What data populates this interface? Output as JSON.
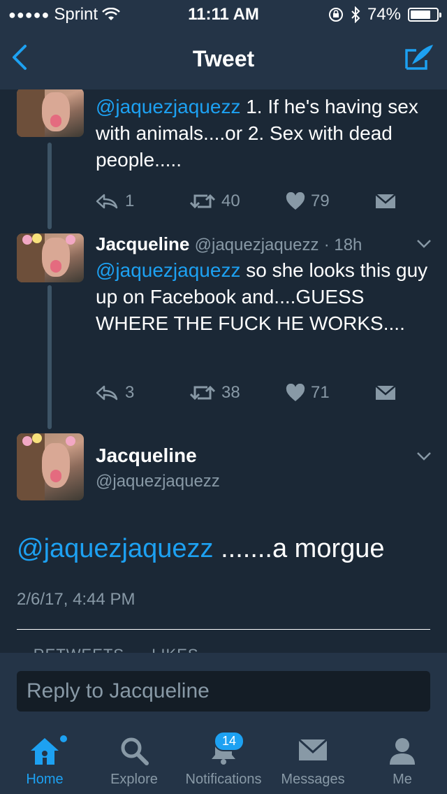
{
  "status": {
    "carrier": "Sprint",
    "time": "11:11 AM",
    "battery": "74%"
  },
  "nav": {
    "title": "Tweet"
  },
  "thread": [
    {
      "mention": "@jaquezjaquezz",
      "text": " 1. If he's having sex with animals....or 2. Sex with dead people.....",
      "replies": "1",
      "retweets": "40",
      "likes": "79"
    },
    {
      "name": "Jacqueline",
      "handle": "@jaquezjaquezz",
      "time": "· 18h",
      "mention": "@jaquezjaquezz",
      "text": " so she looks this guy up on Facebook and....GUESS WHERE THE FUCK HE WORKS....",
      "replies": "3",
      "retweets": "38",
      "likes": "71"
    }
  ],
  "main": {
    "name": "Jacqueline",
    "handle": "@jaquezjaquezz",
    "mention": "@jaquezjaquezz",
    "text": " .......a morgue",
    "timestamp": "2/6/17, 4:44 PM",
    "stats_partial": "-- RETWEETS --- LIKES"
  },
  "reply": {
    "placeholder": "Reply to Jacqueline"
  },
  "tabs": [
    {
      "label": "Home",
      "icon": "home-icon"
    },
    {
      "label": "Explore",
      "icon": "search-icon"
    },
    {
      "label": "Notifications",
      "icon": "bell-icon",
      "badge": "14"
    },
    {
      "label": "Messages",
      "icon": "envelope-icon"
    },
    {
      "label": "Me",
      "icon": "person-icon"
    }
  ],
  "colors": {
    "accent": "#1da1f2",
    "bar": "#243447",
    "background": "#1b2836",
    "muted": "#8899a6"
  }
}
